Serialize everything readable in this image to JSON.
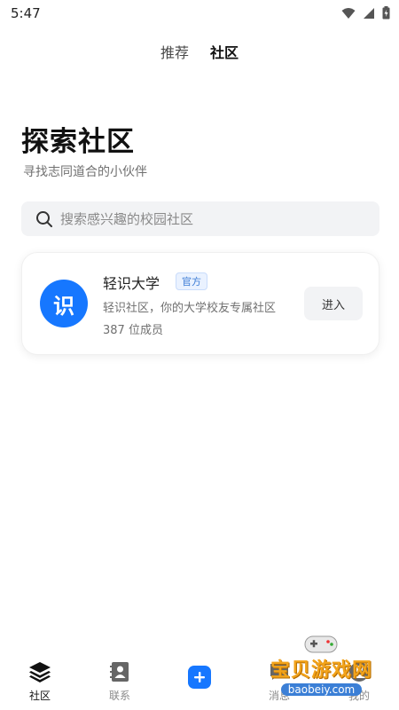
{
  "status_bar": {
    "time": "5:47"
  },
  "top_tabs": [
    {
      "label": "推荐",
      "active": false
    },
    {
      "label": "社区",
      "active": true
    }
  ],
  "page": {
    "title": "探索社区",
    "subtitle": "寻找志同道合的小伙伴"
  },
  "search": {
    "placeholder": "搜索感兴趣的校园社区",
    "value": ""
  },
  "community": {
    "logo_char": "识",
    "name": "轻识大学",
    "badge": "官方",
    "description": "轻识社区，你的大学校友专属社区",
    "members": "387 位成员",
    "enter_label": "进入"
  },
  "bottom_nav": [
    {
      "label": "社区",
      "icon": "layers-icon",
      "active": true
    },
    {
      "label": "联系",
      "icon": "contacts-icon",
      "active": false
    },
    {
      "label": "",
      "icon": "plus-icon",
      "active": false
    },
    {
      "label": "消息",
      "icon": "message-icon",
      "active": false
    },
    {
      "label": "我的",
      "icon": "profile-icon",
      "active": false
    }
  ],
  "watermark": {
    "text": "宝贝游戏网",
    "url": "baobeiy.com"
  },
  "colors": {
    "accent": "#1677ff",
    "badge_text": "#3a7bd5",
    "watermark": "#f2a31b"
  }
}
